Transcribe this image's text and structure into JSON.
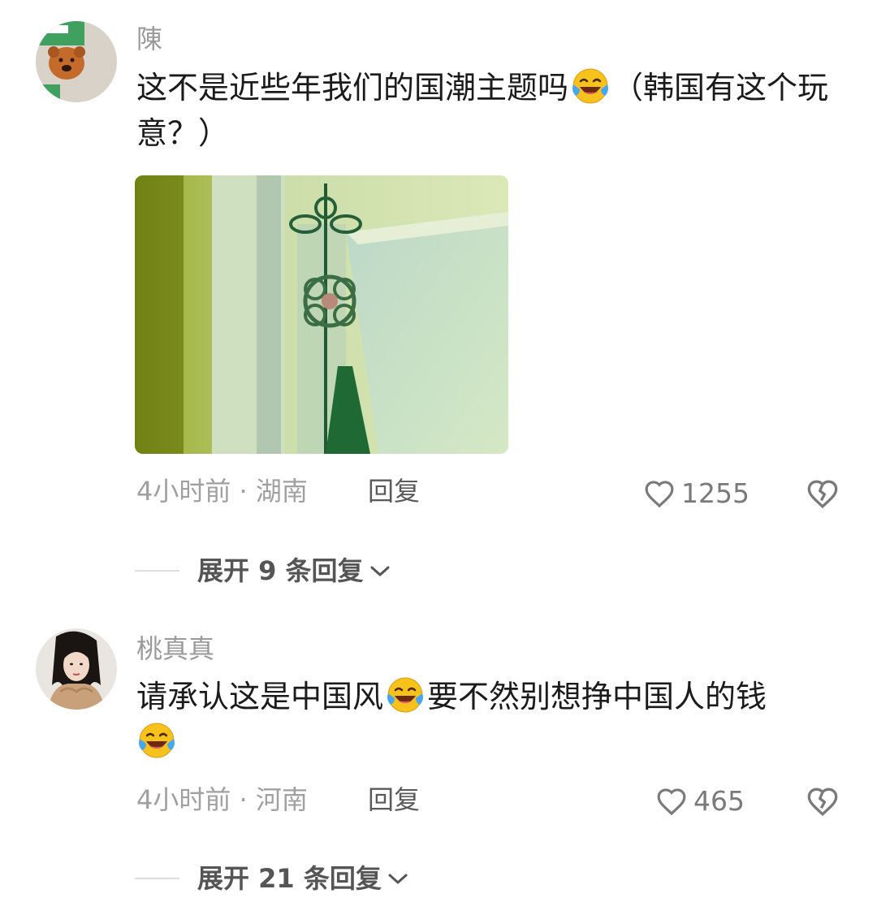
{
  "comments": [
    {
      "username": "陳",
      "text_before": "这不是近些年我们的国潮主题吗",
      "emoji_1": "laughing-crying-emoji",
      "text_after": "（韩国有这个玩意？）",
      "time_location": "4小时前 · 湖南",
      "reply_label": "回复",
      "likes": "1255",
      "expand_label": "展开 9 条回复"
    },
    {
      "username": "桃真真",
      "text_before": "请承认这是中国风",
      "emoji_1": "laughing-crying-emoji",
      "text_after": "要不然别想挣中国人的钱",
      "emoji_2": "laughing-crying-emoji",
      "time_location": "4小时前 · 河南",
      "reply_label": "回复",
      "likes": "465",
      "expand_label": "展开 21 条回复"
    }
  ],
  "colors": {
    "username": "#9a9a9a",
    "text": "#1b1b1b",
    "meta": "#a0a0a0",
    "icon": "#7a7a7a"
  }
}
